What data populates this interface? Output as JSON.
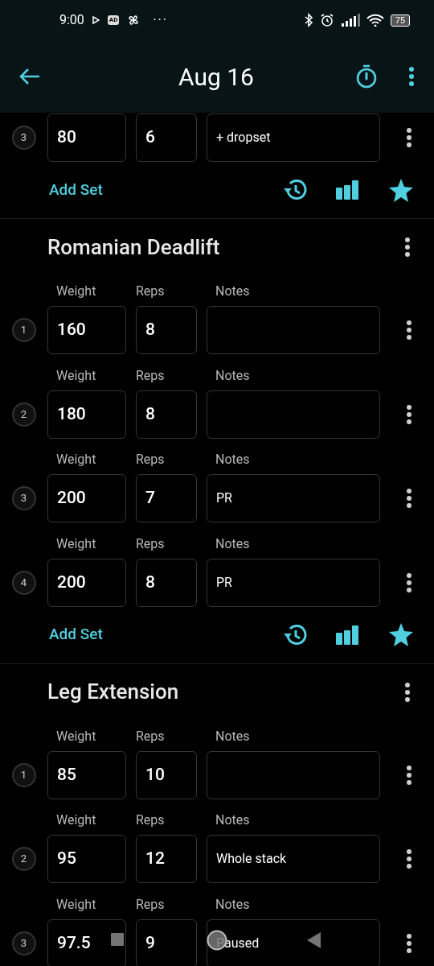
{
  "status_bar": {
    "time": "9:00",
    "ad_badge": "AD",
    "more": "···",
    "battery": "75"
  },
  "app_bar": {
    "title": "Aug 16"
  },
  "exercises": [
    {
      "sets": [
        {
          "index": "3",
          "weight": "80",
          "reps": "6",
          "notes": "+ dropset"
        }
      ],
      "add_set": "Add Set"
    },
    {
      "name": "Romanian Deadlift",
      "sets": [
        {
          "labels": {
            "weight": "Weight",
            "reps": "Reps",
            "notes": "Notes"
          },
          "index": "1",
          "weight": "160",
          "reps": "8"
        },
        {
          "labels": {
            "weight": "Weight",
            "reps": "Reps",
            "notes": "Notes"
          },
          "index": "2",
          "weight": "180",
          "reps": "8"
        },
        {
          "labels": {
            "weight": "Weight",
            "reps": "Reps",
            "notes": "Notes"
          },
          "index": "3",
          "weight": "200",
          "reps": "7",
          "notes": "PR"
        },
        {
          "labels": {
            "weight": "Weight",
            "reps": "Reps",
            "notes": "Notes"
          },
          "index": "4",
          "weight": "200",
          "reps": "8",
          "notes": "PR"
        }
      ],
      "add_set": "Add Set"
    },
    {
      "name": "Leg Extension",
      "sets": [
        {
          "labels": {
            "weight": "Weight",
            "reps": "Reps",
            "notes": "Notes"
          },
          "index": "1",
          "weight": "85",
          "reps": "10"
        },
        {
          "labels": {
            "weight": "Weight",
            "reps": "Reps",
            "notes": "Notes"
          },
          "index": "2",
          "weight": "95",
          "reps": "12",
          "notes": "Whole stack"
        },
        {
          "labels": {
            "weight": "Weight",
            "reps": "Reps",
            "notes": "Notes"
          },
          "index": "3",
          "weight": "97.5",
          "reps": "9",
          "notes": "Paused"
        }
      ]
    }
  ]
}
